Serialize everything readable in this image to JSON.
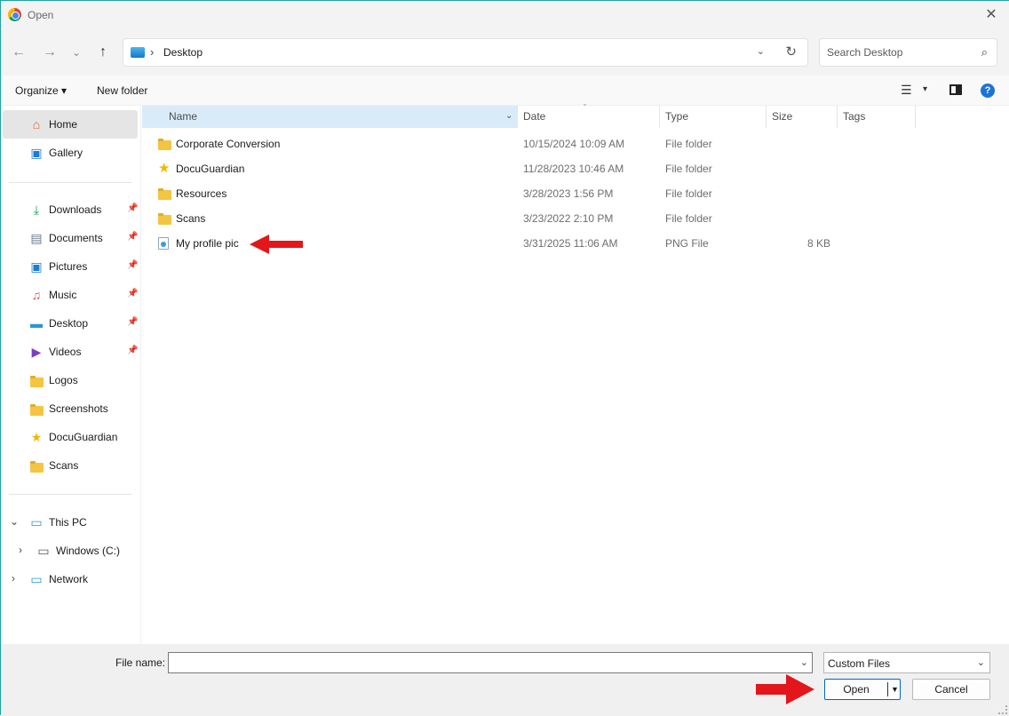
{
  "window": {
    "title": "Open",
    "close_glyph": "✕",
    "app_icon": "chrome-icon"
  },
  "nav": {
    "back_glyph": "←",
    "forward_glyph": "→",
    "recent_glyph": "⌄",
    "up_glyph": "↑",
    "address": {
      "crumb": "Desktop",
      "separator": "›",
      "dropdown_glyph": "⌄",
      "refresh_glyph": "↻"
    },
    "search": {
      "placeholder": "Search Desktop",
      "icon_glyph": "⌕"
    }
  },
  "toolbar": {
    "organize_label": "Organize ▾",
    "new_folder_label": "New folder",
    "view_glyph": "☰",
    "view_caret": "▾",
    "help_glyph": "?"
  },
  "sidebar": {
    "quick": [
      {
        "label": "Home",
        "icon": "home-icon",
        "glyph": "⌂",
        "color": "#d4622a",
        "selected": true
      },
      {
        "label": "Gallery",
        "icon": "gallery-icon",
        "glyph": "▣",
        "color": "#1e7ad6"
      }
    ],
    "pinned": [
      {
        "label": "Downloads",
        "icon": "download-icon",
        "glyph": "⤓",
        "color": "#1e9a5b",
        "pin": "📌"
      },
      {
        "label": "Documents",
        "icon": "documents-icon",
        "glyph": "▤",
        "color": "#6b7a8a",
        "pin": "📌"
      },
      {
        "label": "Pictures",
        "icon": "pictures-icon",
        "glyph": "▣",
        "color": "#1e7ad6",
        "pin": "📌"
      },
      {
        "label": "Music",
        "icon": "music-icon",
        "glyph": "♫",
        "color": "#d9534f",
        "pin": "📌"
      },
      {
        "label": "Desktop",
        "icon": "desktop-icon",
        "glyph": "▬",
        "color": "#2a95d8",
        "pin": "📌"
      },
      {
        "label": "Videos",
        "icon": "videos-icon",
        "glyph": "▶",
        "color": "#7b3fbf",
        "pin": "📌"
      },
      {
        "label": "Logos",
        "icon": "folder-icon"
      },
      {
        "label": "Screenshots",
        "icon": "folder-icon"
      },
      {
        "label": "DocuGuardian",
        "icon": "star-icon",
        "glyph": "★",
        "color": "#f2b600"
      },
      {
        "label": "Scans",
        "icon": "folder-icon"
      }
    ],
    "tree": [
      {
        "label": "This PC",
        "icon": "computer-icon",
        "glyph": "▭",
        "expander": "⌄",
        "color": "#2a95d8"
      },
      {
        "label": "Windows (C:)",
        "icon": "drive-icon",
        "glyph": "▭",
        "expander": "›",
        "color": "#555555"
      },
      {
        "label": "Network",
        "icon": "network-icon",
        "glyph": "▭",
        "expander": "›",
        "color": "#2a95d8"
      }
    ]
  },
  "columns": {
    "name": "Name",
    "date": "Date",
    "type": "Type",
    "size": "Size",
    "tags": "Tags",
    "sort_glyph": "ˇ",
    "name_caret": "⌄"
  },
  "files": [
    {
      "name": "Corporate Conversion",
      "date": "10/15/2024 10:09 AM",
      "type": "File folder",
      "size": "",
      "icon": "folder"
    },
    {
      "name": "DocuGuardian",
      "date": "11/28/2023 10:46 AM",
      "type": "File folder",
      "size": "",
      "icon": "star"
    },
    {
      "name": "Resources",
      "date": "3/28/2023 1:56 PM",
      "type": "File folder",
      "size": "",
      "icon": "folder"
    },
    {
      "name": "Scans",
      "date": "3/23/2022 2:10 PM",
      "type": "File folder",
      "size": "",
      "icon": "folder"
    },
    {
      "name": "My profile pic",
      "date": "3/31/2025 11:06 AM",
      "type": "PNG File",
      "size": "8 KB",
      "icon": "png"
    }
  ],
  "footer": {
    "file_name_label": "File name:",
    "file_name_value": "",
    "dropdown_glyph": "⌄",
    "filter_value": "Custom Files",
    "open_label": "Open",
    "open_caret": "▼",
    "cancel_label": "Cancel"
  },
  "colors": {
    "accent": "#0067c0",
    "annotation_arrow": "#e3161b",
    "selected_header": "#d9ebf9"
  }
}
